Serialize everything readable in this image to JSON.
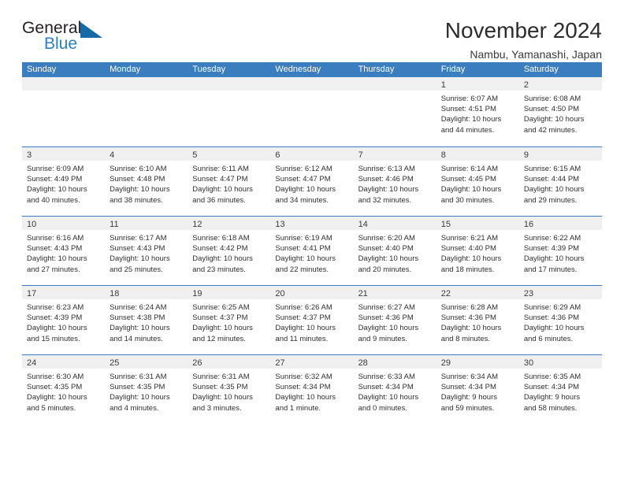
{
  "brand": {
    "name_dark": "General",
    "name_blue": "Blue",
    "triangle_icon": "blue-triangle-icon"
  },
  "header": {
    "title": "November 2024",
    "subtitle": "Nambu, Yamanashi, Japan"
  },
  "colors": {
    "header_blue": "#3a7ebf",
    "brand_blue": "#2980c4",
    "triangle_blue": "#1769a8",
    "day_band_gray": "#f0f0f0",
    "text_dark": "#2f2f2f"
  },
  "weekdays": [
    "Sunday",
    "Monday",
    "Tuesday",
    "Wednesday",
    "Thursday",
    "Friday",
    "Saturday"
  ],
  "weeks": [
    [
      {
        "day": "",
        "lines": []
      },
      {
        "day": "",
        "lines": []
      },
      {
        "day": "",
        "lines": []
      },
      {
        "day": "",
        "lines": []
      },
      {
        "day": "",
        "lines": []
      },
      {
        "day": "1",
        "lines": [
          "Sunrise: 6:07 AM",
          "Sunset: 4:51 PM",
          "Daylight: 10 hours",
          "and 44 minutes."
        ]
      },
      {
        "day": "2",
        "lines": [
          "Sunrise: 6:08 AM",
          "Sunset: 4:50 PM",
          "Daylight: 10 hours",
          "and 42 minutes."
        ]
      }
    ],
    [
      {
        "day": "3",
        "lines": [
          "Sunrise: 6:09 AM",
          "Sunset: 4:49 PM",
          "Daylight: 10 hours",
          "and 40 minutes."
        ]
      },
      {
        "day": "4",
        "lines": [
          "Sunrise: 6:10 AM",
          "Sunset: 4:48 PM",
          "Daylight: 10 hours",
          "and 38 minutes."
        ]
      },
      {
        "day": "5",
        "lines": [
          "Sunrise: 6:11 AM",
          "Sunset: 4:47 PM",
          "Daylight: 10 hours",
          "and 36 minutes."
        ]
      },
      {
        "day": "6",
        "lines": [
          "Sunrise: 6:12 AM",
          "Sunset: 4:47 PM",
          "Daylight: 10 hours",
          "and 34 minutes."
        ]
      },
      {
        "day": "7",
        "lines": [
          "Sunrise: 6:13 AM",
          "Sunset: 4:46 PM",
          "Daylight: 10 hours",
          "and 32 minutes."
        ]
      },
      {
        "day": "8",
        "lines": [
          "Sunrise: 6:14 AM",
          "Sunset: 4:45 PM",
          "Daylight: 10 hours",
          "and 30 minutes."
        ]
      },
      {
        "day": "9",
        "lines": [
          "Sunrise: 6:15 AM",
          "Sunset: 4:44 PM",
          "Daylight: 10 hours",
          "and 29 minutes."
        ]
      }
    ],
    [
      {
        "day": "10",
        "lines": [
          "Sunrise: 6:16 AM",
          "Sunset: 4:43 PM",
          "Daylight: 10 hours",
          "and 27 minutes."
        ]
      },
      {
        "day": "11",
        "lines": [
          "Sunrise: 6:17 AM",
          "Sunset: 4:43 PM",
          "Daylight: 10 hours",
          "and 25 minutes."
        ]
      },
      {
        "day": "12",
        "lines": [
          "Sunrise: 6:18 AM",
          "Sunset: 4:42 PM",
          "Daylight: 10 hours",
          "and 23 minutes."
        ]
      },
      {
        "day": "13",
        "lines": [
          "Sunrise: 6:19 AM",
          "Sunset: 4:41 PM",
          "Daylight: 10 hours",
          "and 22 minutes."
        ]
      },
      {
        "day": "14",
        "lines": [
          "Sunrise: 6:20 AM",
          "Sunset: 4:40 PM",
          "Daylight: 10 hours",
          "and 20 minutes."
        ]
      },
      {
        "day": "15",
        "lines": [
          "Sunrise: 6:21 AM",
          "Sunset: 4:40 PM",
          "Daylight: 10 hours",
          "and 18 minutes."
        ]
      },
      {
        "day": "16",
        "lines": [
          "Sunrise: 6:22 AM",
          "Sunset: 4:39 PM",
          "Daylight: 10 hours",
          "and 17 minutes."
        ]
      }
    ],
    [
      {
        "day": "17",
        "lines": [
          "Sunrise: 6:23 AM",
          "Sunset: 4:39 PM",
          "Daylight: 10 hours",
          "and 15 minutes."
        ]
      },
      {
        "day": "18",
        "lines": [
          "Sunrise: 6:24 AM",
          "Sunset: 4:38 PM",
          "Daylight: 10 hours",
          "and 14 minutes."
        ]
      },
      {
        "day": "19",
        "lines": [
          "Sunrise: 6:25 AM",
          "Sunset: 4:37 PM",
          "Daylight: 10 hours",
          "and 12 minutes."
        ]
      },
      {
        "day": "20",
        "lines": [
          "Sunrise: 6:26 AM",
          "Sunset: 4:37 PM",
          "Daylight: 10 hours",
          "and 11 minutes."
        ]
      },
      {
        "day": "21",
        "lines": [
          "Sunrise: 6:27 AM",
          "Sunset: 4:36 PM",
          "Daylight: 10 hours",
          "and 9 minutes."
        ]
      },
      {
        "day": "22",
        "lines": [
          "Sunrise: 6:28 AM",
          "Sunset: 4:36 PM",
          "Daylight: 10 hours",
          "and 8 minutes."
        ]
      },
      {
        "day": "23",
        "lines": [
          "Sunrise: 6:29 AM",
          "Sunset: 4:36 PM",
          "Daylight: 10 hours",
          "and 6 minutes."
        ]
      }
    ],
    [
      {
        "day": "24",
        "lines": [
          "Sunrise: 6:30 AM",
          "Sunset: 4:35 PM",
          "Daylight: 10 hours",
          "and 5 minutes."
        ]
      },
      {
        "day": "25",
        "lines": [
          "Sunrise: 6:31 AM",
          "Sunset: 4:35 PM",
          "Daylight: 10 hours",
          "and 4 minutes."
        ]
      },
      {
        "day": "26",
        "lines": [
          "Sunrise: 6:31 AM",
          "Sunset: 4:35 PM",
          "Daylight: 10 hours",
          "and 3 minutes."
        ]
      },
      {
        "day": "27",
        "lines": [
          "Sunrise: 6:32 AM",
          "Sunset: 4:34 PM",
          "Daylight: 10 hours",
          "and 1 minute."
        ]
      },
      {
        "day": "28",
        "lines": [
          "Sunrise: 6:33 AM",
          "Sunset: 4:34 PM",
          "Daylight: 10 hours",
          "and 0 minutes."
        ]
      },
      {
        "day": "29",
        "lines": [
          "Sunrise: 6:34 AM",
          "Sunset: 4:34 PM",
          "Daylight: 9 hours",
          "and 59 minutes."
        ]
      },
      {
        "day": "30",
        "lines": [
          "Sunrise: 6:35 AM",
          "Sunset: 4:34 PM",
          "Daylight: 9 hours",
          "and 58 minutes."
        ]
      }
    ]
  ]
}
